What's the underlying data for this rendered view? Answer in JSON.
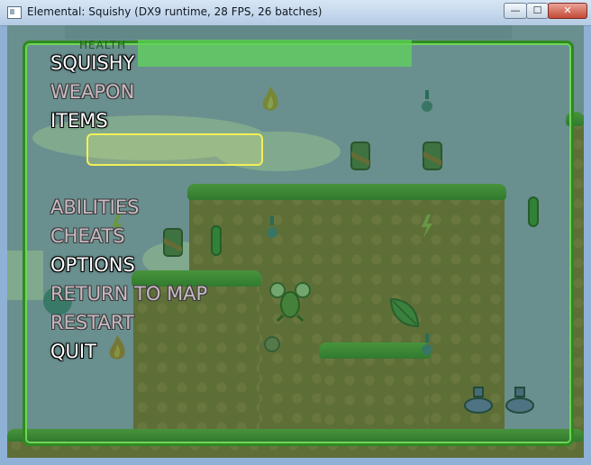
{
  "window": {
    "title": "Elemental: Squishy (DX9 runtime, 28 FPS, 26 batches)",
    "buttons": {
      "minimize": "—",
      "maximize": "☐",
      "close": "✕"
    }
  },
  "hud": {
    "health_label": "HEALTH",
    "health_fraction": 0.76
  },
  "menu": {
    "items": [
      {
        "label": "SQUISHY",
        "state": "active"
      },
      {
        "label": "WEAPON",
        "state": "dim"
      },
      {
        "label": "ITEMS",
        "state": "active"
      },
      {
        "label": "ABILITIES",
        "state": "dim"
      },
      {
        "label": "CHEATS",
        "state": "dim"
      },
      {
        "label": "OPTIONS",
        "state": "active"
      },
      {
        "label": "RETURN TO MAP",
        "state": "dim"
      },
      {
        "label": "RESTART",
        "state": "dim"
      },
      {
        "label": "QUIT",
        "state": "active"
      }
    ]
  },
  "colors": {
    "frame": "#2f8a1f",
    "selector": "#f2f05a",
    "overlay": "rgba(40,110,50,0.55)"
  },
  "sprites": [
    "fire-icon",
    "flask-icon",
    "can-icon",
    "can-icon",
    "tube-icon",
    "lightning-icon",
    "flask-icon",
    "can-icon",
    "tube-icon",
    "lightning-icon",
    "leaf-icon",
    "flask-icon",
    "shell-icon",
    "fire-icon",
    "potion-icon",
    "potion-icon",
    "player-character"
  ]
}
